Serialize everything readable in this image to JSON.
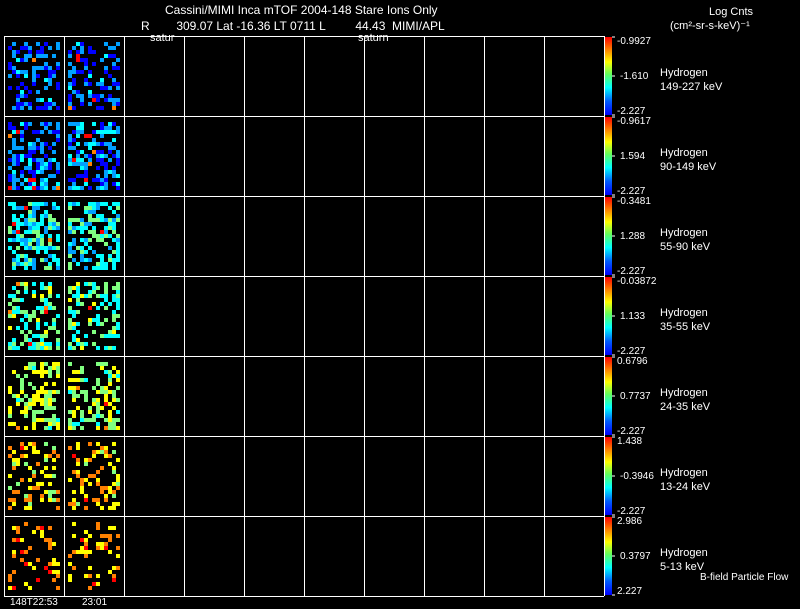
{
  "header": {
    "title": "Cassini/MIMI Inca mTOF  2004-148   Stare   Ions Only",
    "ephemeris": "R        309.07 Lat -16.36 LT 0711 L         44.43  MIMI/APL",
    "units_line1": "Log Cnts",
    "units_line2": "(cm²-sr-s-keV)⁻¹",
    "saturn_label_1": "satur",
    "saturn_label_2": "saturn"
  },
  "footer": {
    "time_labels": [
      "148T22:53",
      "23:01"
    ],
    "flow_label": "B-field Particle Flow"
  },
  "chart_data": {
    "type": "heatmap",
    "title": "Cassini/MIMI Inca mTOF  2004-148   Stare   Ions Only",
    "colorbar_title": "Log Cnts (cm²-sr-s-keV)⁻¹",
    "colormap": [
      "#0000ff",
      "#00a0ff",
      "#00ffff",
      "#80ff80",
      "#ffff00",
      "#ff8000",
      "#ff0000"
    ],
    "time_labels": [
      "148T22:53",
      "23:01"
    ],
    "frames_per_row": 10,
    "frames_with_data": 2,
    "rows": [
      {
        "species": "Hydrogen",
        "energy": "149-227 keV",
        "cb_max": "-0.9927",
        "cb_mid": "-1.610",
        "cb_min": "-2.227"
      },
      {
        "species": "Hydrogen",
        "energy": "90-149 keV",
        "cb_max": "-0.9617",
        "cb_mid": "1.594",
        "cb_min": "-2.227"
      },
      {
        "species": "Hydrogen",
        "energy": "55-90 keV",
        "cb_max": "-0.3481",
        "cb_mid": "1.288",
        "cb_min": "-2.227"
      },
      {
        "species": "Hydrogen",
        "energy": "35-55 keV",
        "cb_max": "-0.03872",
        "cb_mid": "1.133",
        "cb_min": "-2.227"
      },
      {
        "species": "Hydrogen",
        "energy": "24-35 keV",
        "cb_max": "0.6796",
        "cb_mid": "0.7737",
        "cb_min": "-2.227"
      },
      {
        "species": "Hydrogen",
        "energy": "13-24 keV",
        "cb_max": "1.438",
        "cb_mid": "-0.3946",
        "cb_min": "-2.227"
      },
      {
        "species": "Hydrogen",
        "energy": "5-13 keV",
        "cb_max": "2.986",
        "cb_mid": "0.3797",
        "cb_min": "2.227"
      }
    ]
  }
}
